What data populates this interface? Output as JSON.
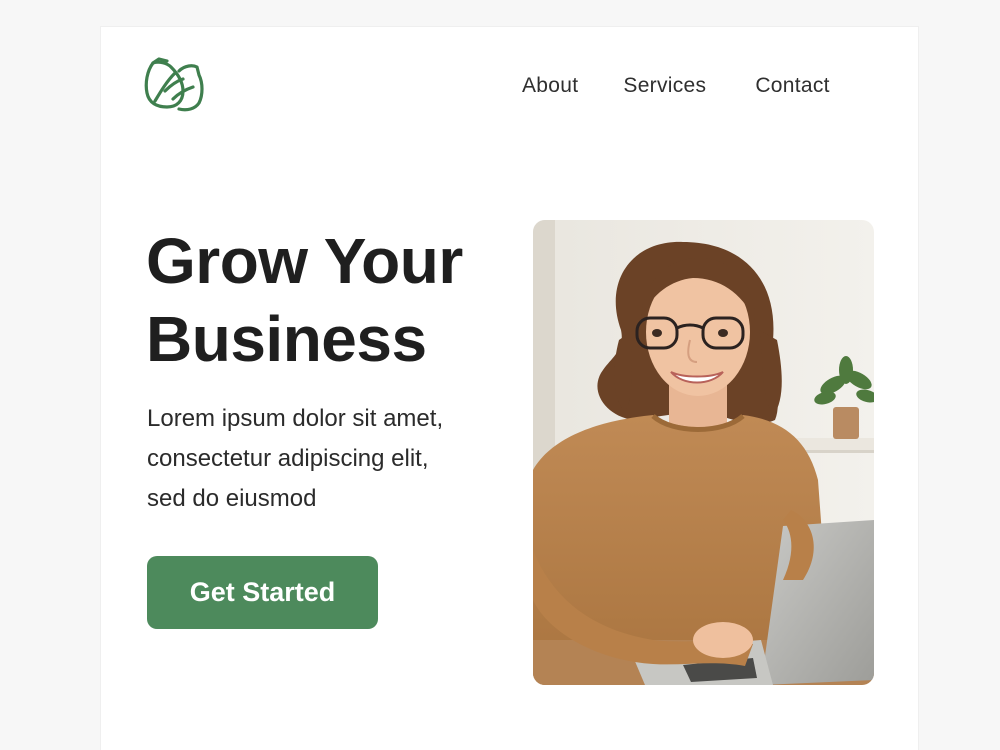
{
  "nav": {
    "items": [
      {
        "label": "About"
      },
      {
        "label": "Services"
      },
      {
        "label": "Contact"
      }
    ]
  },
  "hero": {
    "title_line1": "Grow Your",
    "title_line2": "Business",
    "text_line1": "Lorem ipsum dolor sit amet,",
    "text_line2": "consectetur adipiscing elit,",
    "text_line3": "sed do eiusmod",
    "cta_label": "Get Started"
  },
  "colors": {
    "brand_green": "#4d8a5c",
    "page_background": "#f7f7f7",
    "card_background": "#ffffff"
  },
  "icons": {
    "logo": "leaf-pot-logo-icon"
  }
}
